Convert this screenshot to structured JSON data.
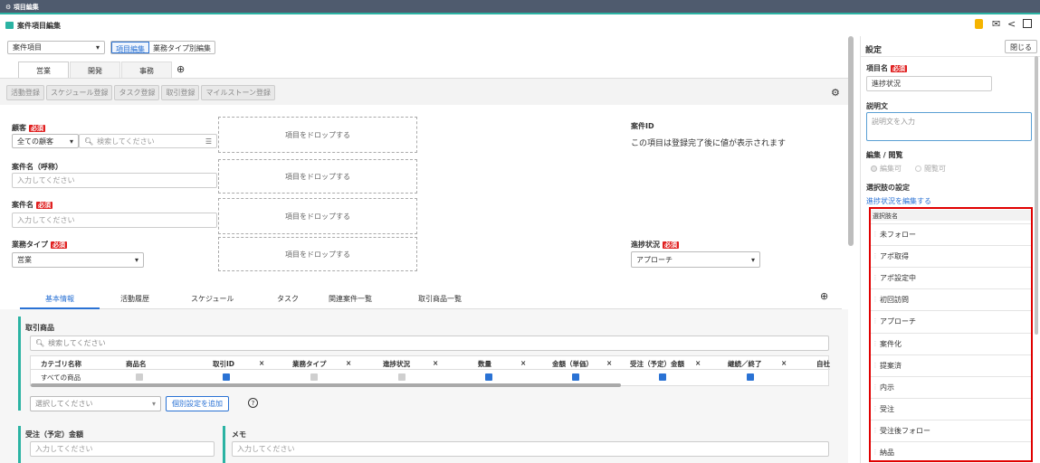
{
  "window_title": "項目編集",
  "header": {
    "title": "案件項目編集"
  },
  "toolbar": {
    "object_select": "案件項目",
    "mode_edit": "項目編集",
    "mode_type": "業務タイプ別編集"
  },
  "top_tabs": [
    "営業",
    "開発",
    "事務"
  ],
  "action_buttons": [
    "活動登録",
    "スケジュール登録",
    "タスク登録",
    "取引登録",
    "マイルストーン登録"
  ],
  "required": "必須",
  "fields": {
    "customer_label": "顧客",
    "customer_scope": "全ての顧客",
    "customer_search": "検索してください",
    "name_alias_label": "案件名（呼称）",
    "placeholder": "入力してください",
    "name_label": "案件名",
    "business_type_label": "業務タイプ",
    "business_type_value": "営業",
    "deal_id_label": "案件ID",
    "deal_id_note": "この項目は登録完了後に値が表示されます",
    "progress_label": "進捗状況",
    "progress_value": "アプローチ",
    "drop_text": "項目をドロップする"
  },
  "detail_tabs": [
    "基本情報",
    "活動履歴",
    "スケジュール",
    "タスク",
    "関連案件一覧",
    "取引商品一覧"
  ],
  "products": {
    "title": "取引商品",
    "search_placeholder": "検索してください",
    "columns": [
      "カテゴリ名称",
      "商品名",
      "取引ID",
      "業務タイプ",
      "進捗状況",
      "数量",
      "金額（単価）",
      "受注（予定）金額",
      "継続／終了",
      "自社"
    ],
    "close_mark": "×",
    "row_label": "すべての商品",
    "select_placeholder": "選択してください",
    "add_button": "個別設定を追加",
    "help": "?"
  },
  "lower_fields": {
    "amount_label": "受注（予定）金額",
    "memo_label": "メモ",
    "placeholder": "入力してください"
  },
  "settings": {
    "title": "設定",
    "close": "閉じる",
    "item_name_label": "項目名",
    "item_name_value": "進捗状況",
    "description_label": "説明文",
    "description_placeholder": "説明文を入力",
    "edit_label": "編集 / 閲覧",
    "edit_ok": "編集可",
    "view_ok": "閲覧可",
    "choices_label": "選択肢の設定",
    "edit_link": "進捗状況を編集する",
    "choice_header": "選択肢名",
    "choices": [
      "未フォロー",
      "アポ取得",
      "アポ設定中",
      "初回訪問",
      "アプローチ",
      "案件化",
      "提案済",
      "内示",
      "受注",
      "受注後フォロー",
      "納品"
    ]
  },
  "colors": {
    "accent": "#2a72d4",
    "topbar": "#4f5b6e",
    "teal": "#2bb3a3",
    "required": "#e02020",
    "highlight": "#e00000",
    "lock": "#f5b400"
  }
}
